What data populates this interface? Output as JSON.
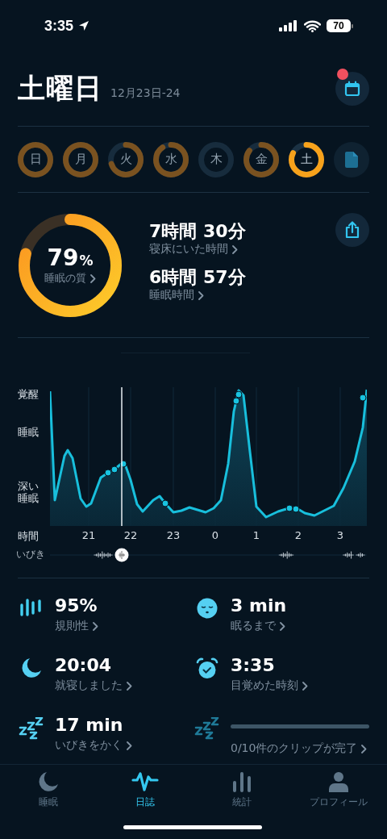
{
  "status_bar": {
    "time": "3:35",
    "battery": "70"
  },
  "header": {
    "title": "土曜日",
    "date": "12月23日-24",
    "calendar_badge": true
  },
  "days": [
    {
      "label": "日",
      "selected": false
    },
    {
      "label": "月",
      "selected": false
    },
    {
      "label": "火",
      "selected": false
    },
    {
      "label": "水",
      "selected": false
    },
    {
      "label": "木",
      "selected": false
    },
    {
      "label": "金",
      "selected": false
    },
    {
      "label": "土",
      "selected": true
    }
  ],
  "summary": {
    "quality": {
      "value": "79",
      "unit": "%",
      "label": "睡眠の質"
    },
    "durations": [
      {
        "value": "7時間 30分",
        "label": "寝床にいた時間"
      },
      {
        "value": "6時間 57分",
        "label": "睡眠時間"
      }
    ]
  },
  "graph": {
    "y_labels": [
      "覚醒",
      "睡眠",
      "深い睡眠"
    ],
    "x_title": "時間",
    "x_labels": [
      "21",
      "22",
      "23",
      "0",
      "1",
      "2",
      "3"
    ],
    "snore_label": "いびき"
  },
  "stats": [
    {
      "kind": "value",
      "value": "95%",
      "label": "規則性"
    },
    {
      "kind": "value",
      "value": "3 min",
      "label": "眠るまで"
    },
    {
      "kind": "value",
      "value": "20:04",
      "label": "就寝しました"
    },
    {
      "kind": "value",
      "value": "3:35",
      "label": "目覚めた時刻"
    },
    {
      "kind": "value",
      "value": "17 min",
      "label": "いびきをかく"
    },
    {
      "kind": "progress",
      "level": 0,
      "label": "0/10件のクリップが完了"
    }
  ],
  "tabs": [
    {
      "label": "睡眠",
      "selected": false
    },
    {
      "label": "日誌",
      "selected": true
    },
    {
      "label": "統計",
      "selected": false
    },
    {
      "label": "プロフィール",
      "selected": false
    }
  ]
}
